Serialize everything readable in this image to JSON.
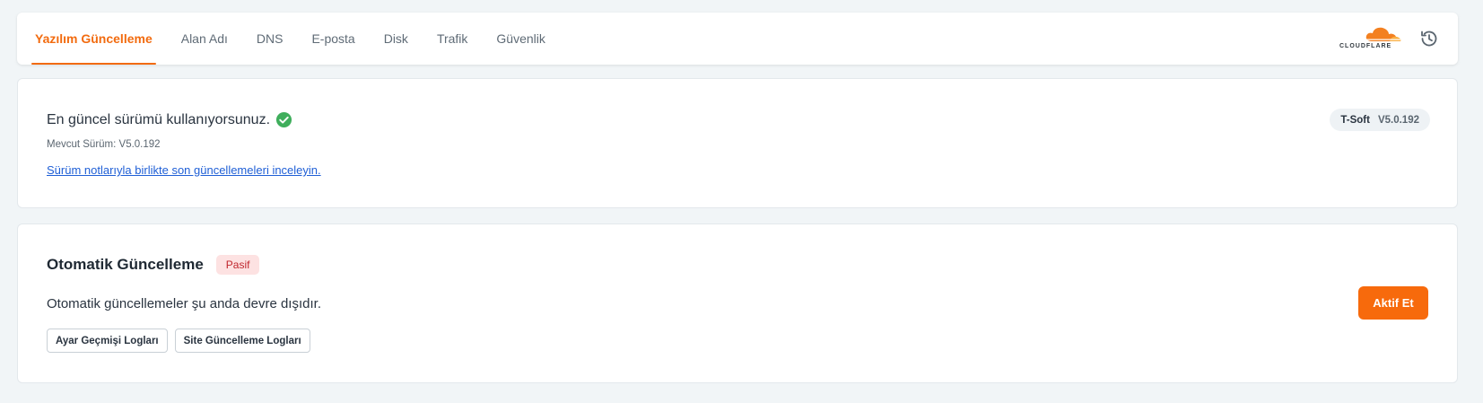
{
  "tabs": [
    {
      "label": "Yazılım Güncelleme",
      "active": true
    },
    {
      "label": "Alan Adı",
      "active": false
    },
    {
      "label": "DNS",
      "active": false
    },
    {
      "label": "E-posta",
      "active": false
    },
    {
      "label": "Disk",
      "active": false
    },
    {
      "label": "Trafik",
      "active": false
    },
    {
      "label": "Güvenlik",
      "active": false
    }
  ],
  "brand": {
    "logo_text": "CLOUDFLARE",
    "logo_icon": "cloudflare-cloud-icon",
    "history_icon": "history-icon"
  },
  "version_card": {
    "status_text": "En güncel sürümü kullanıyorsunuz.",
    "status_icon": "check-circle-icon",
    "current_version": "Mevcut Sürüm: V5.0.192",
    "notes_link": "Sürüm notlarıyla birlikte son güncellemeleri inceleyin.",
    "badge_name": "T-Soft",
    "badge_version": "V5.0.192"
  },
  "auto_update_card": {
    "title": "Otomatik Güncelleme",
    "status_badge": "Pasif",
    "description": "Otomatik güncellemeler şu anda devre dışıdır.",
    "buttons": [
      "Ayar Geçmişi Logları",
      "Site Güncelleme Logları"
    ],
    "activate_label": "Aktif Et"
  },
  "colors": {
    "accent": "#f26b0f",
    "activate_button": "#f76a0c",
    "success": "#3fae5c",
    "link": "#1f5fd6",
    "inactive_badge_bg": "#fde2e2",
    "inactive_badge_text": "#c0262d",
    "background": "#f1f5f7"
  }
}
